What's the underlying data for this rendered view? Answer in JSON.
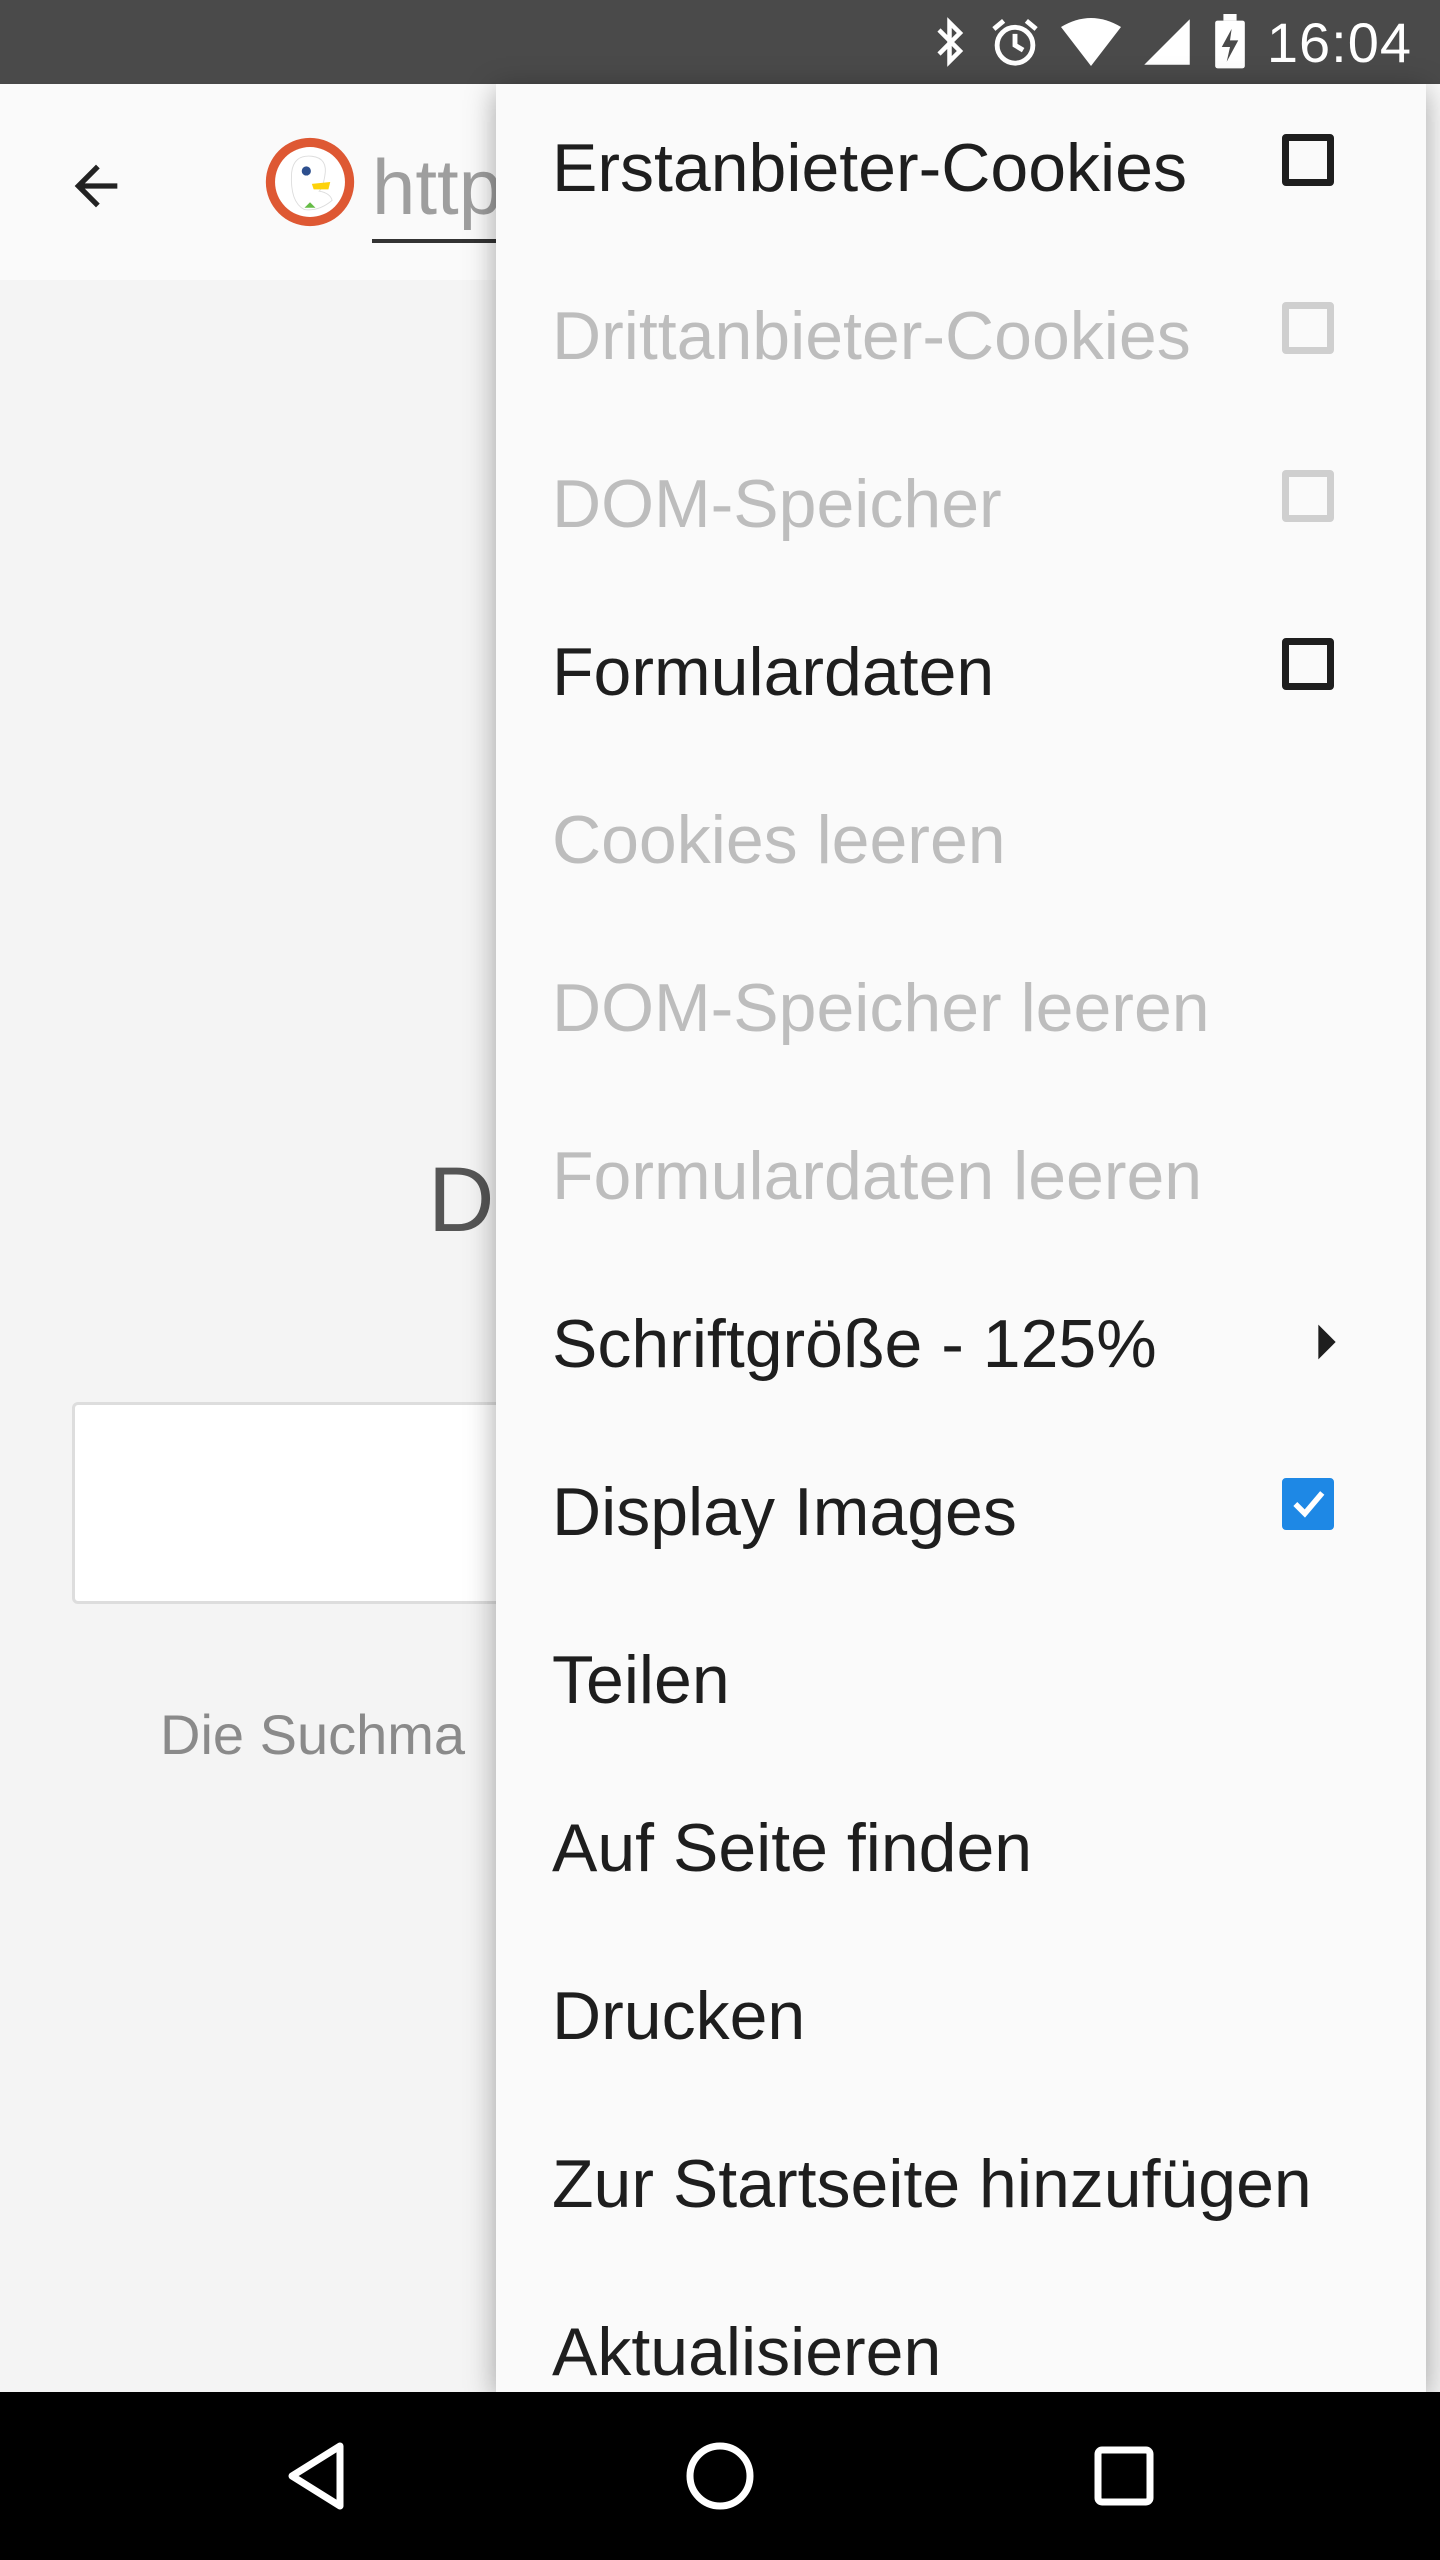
{
  "status_bar": {
    "time": "16:04",
    "icons": [
      "bluetooth-icon",
      "alarm-icon",
      "wifi-icon",
      "cell-signal-icon",
      "battery-charging-icon"
    ]
  },
  "toolbar": {
    "url_text": "http",
    "back_icon": "arrow-left-icon",
    "logo": "duckduckgo-logo"
  },
  "page": {
    "heading_fragment": "D",
    "subtext_fragment": "Die Suchma"
  },
  "menu": {
    "items": [
      {
        "label": "Erstanbieter-Cookies",
        "enabled": true,
        "checkbox": "unchecked"
      },
      {
        "label": "Drittanbieter-Cookies",
        "enabled": false,
        "checkbox": "unchecked"
      },
      {
        "label": "DOM-Speicher",
        "enabled": false,
        "checkbox": "unchecked"
      },
      {
        "label": "Formulardaten",
        "enabled": true,
        "checkbox": "unchecked"
      },
      {
        "label": "Cookies leeren",
        "enabled": false
      },
      {
        "label": "DOM-Speicher leeren",
        "enabled": false
      },
      {
        "label": "Formulardaten leeren",
        "enabled": false
      },
      {
        "label": "Schriftgröße - 125%",
        "enabled": true,
        "submenu": true
      },
      {
        "label": "Display Images",
        "enabled": true,
        "checkbox": "checked"
      },
      {
        "label": "Teilen",
        "enabled": true
      },
      {
        "label": "Auf Seite finden",
        "enabled": true
      },
      {
        "label": "Drucken",
        "enabled": true
      },
      {
        "label": "Zur Startseite hinzufügen",
        "enabled": true
      },
      {
        "label": "Aktualisieren",
        "enabled": true
      }
    ]
  },
  "colors": {
    "checkbox_checked": "#1e88e5",
    "disabled_text": "#bdbdbd",
    "status_bar": "#4a4a4a"
  },
  "nav_bar": {
    "icons": [
      "back-triangle-icon",
      "home-circle-icon",
      "recents-square-icon"
    ]
  }
}
